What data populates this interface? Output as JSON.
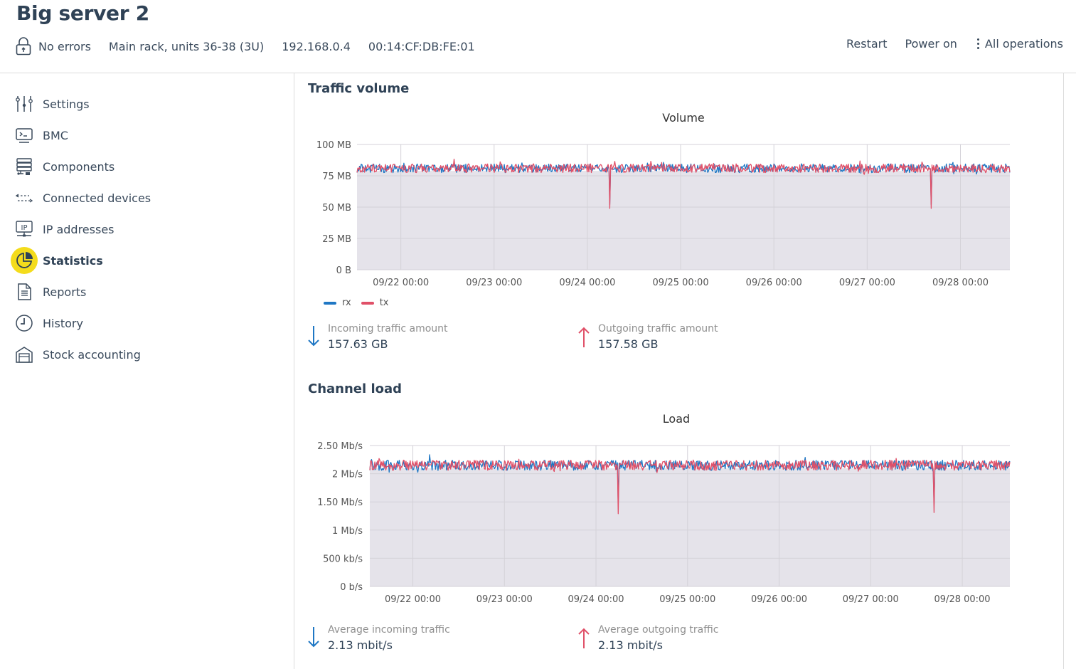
{
  "header": {
    "title": "Big server 2",
    "status": "No errors",
    "location": "Main rack, units 36-38 (3U)",
    "ip": "192.168.0.4",
    "mac": "00:14:CF:DB:FE:01",
    "actions": {
      "restart": "Restart",
      "power_on": "Power on",
      "all_operations": "All operations"
    }
  },
  "sidebar": {
    "items": [
      {
        "label": "Settings",
        "icon": "sliders-icon"
      },
      {
        "label": "BMC",
        "icon": "terminal-icon"
      },
      {
        "label": "Components",
        "icon": "server-icon"
      },
      {
        "label": "Connected devices",
        "icon": "arrows-icon"
      },
      {
        "label": "IP addresses",
        "icon": "ip-icon"
      },
      {
        "label": "Statistics",
        "icon": "pie-chart-icon",
        "active": true
      },
      {
        "label": "Reports",
        "icon": "document-icon"
      },
      {
        "label": "History",
        "icon": "clock-icon"
      },
      {
        "label": "Stock accounting",
        "icon": "warehouse-icon"
      }
    ]
  },
  "colors": {
    "rx": "#1f77c4",
    "tx": "#e05068",
    "plot_bg": "#e5e3ea",
    "accent": "#f4dc1c"
  },
  "sections": {
    "traffic_volume": {
      "title": "Traffic volume",
      "stats": {
        "incoming_label": "Incoming traffic amount",
        "incoming_value": "157.63 GB",
        "outgoing_label": "Outgoing traffic amount",
        "outgoing_value": "157.58 GB"
      }
    },
    "channel_load": {
      "title": "Channel load",
      "stats": {
        "incoming_label": "Average incoming traffic",
        "incoming_value": "2.13 mbit/s",
        "outgoing_label": "Average outgoing traffic",
        "outgoing_value": "2.13 mbit/s"
      }
    }
  },
  "chart_data": [
    {
      "type": "line",
      "title": "Volume",
      "xlabel": "",
      "ylabel": "",
      "x_range_days": [
        -0.47,
        6.53
      ],
      "x_origin": "09/22 00:00",
      "ylim": [
        0,
        100
      ],
      "y_unit": "MB",
      "y_ticks": [
        0,
        25,
        50,
        75,
        100
      ],
      "y_tick_labels": [
        "0 B",
        "25 MB",
        "50 MB",
        "75 MB",
        "100 MB"
      ],
      "x_ticks": [
        0,
        1,
        2,
        3,
        4,
        5,
        6
      ],
      "x_tick_labels": [
        "09/22 00:00",
        "09/23 00:00",
        "09/24 00:00",
        "09/25 00:00",
        "09/26 00:00",
        "09/27 00:00",
        "09/28 00:00"
      ],
      "grid": true,
      "legend": "bottom-left",
      "series": [
        {
          "name": "rx",
          "baseline": 81,
          "noise": 3.5,
          "min": 73,
          "max": 91,
          "dips": [
            {
              "day": 2.24,
              "value": 52
            },
            {
              "day": 5.69,
              "value": 52
            }
          ]
        },
        {
          "name": "tx",
          "baseline": 81,
          "noise": 3.5,
          "min": 71,
          "max": 90,
          "dips": [
            {
              "day": 2.24,
              "value": 49
            },
            {
              "day": 5.69,
              "value": 49
            }
          ]
        }
      ]
    },
    {
      "type": "line",
      "title": "Load",
      "xlabel": "",
      "ylabel": "",
      "x_range_days": [
        -0.47,
        6.52
      ],
      "x_origin": "09/22 00:00",
      "ylim": [
        0,
        2.5
      ],
      "y_unit": "Mb/s",
      "y_ticks": [
        0,
        0.5,
        1,
        1.5,
        2,
        2.5
      ],
      "y_tick_labels": [
        "0 b/s",
        "500 kb/s",
        "1 Mb/s",
        "1.50 Mb/s",
        "2 Mb/s",
        "2.50 Mb/s"
      ],
      "x_ticks": [
        0,
        1,
        2,
        3,
        4,
        5,
        6
      ],
      "x_tick_labels": [
        "09/22 00:00",
        "09/23 00:00",
        "09/24 00:00",
        "09/25 00:00",
        "09/26 00:00",
        "09/27 00:00",
        "09/28 00:00"
      ],
      "grid": true,
      "series": [
        {
          "name": "rx",
          "baseline": 2.15,
          "noise": 0.09,
          "min": 1.93,
          "max": 2.38,
          "dips": [
            {
              "day": 2.24,
              "value": 1.45
            },
            {
              "day": 5.69,
              "value": 1.45
            }
          ]
        },
        {
          "name": "tx",
          "baseline": 2.15,
          "noise": 0.09,
          "min": 1.86,
          "max": 2.42,
          "dips": [
            {
              "day": 2.24,
              "value": 1.29
            },
            {
              "day": 5.69,
              "value": 1.31
            }
          ]
        }
      ]
    }
  ]
}
